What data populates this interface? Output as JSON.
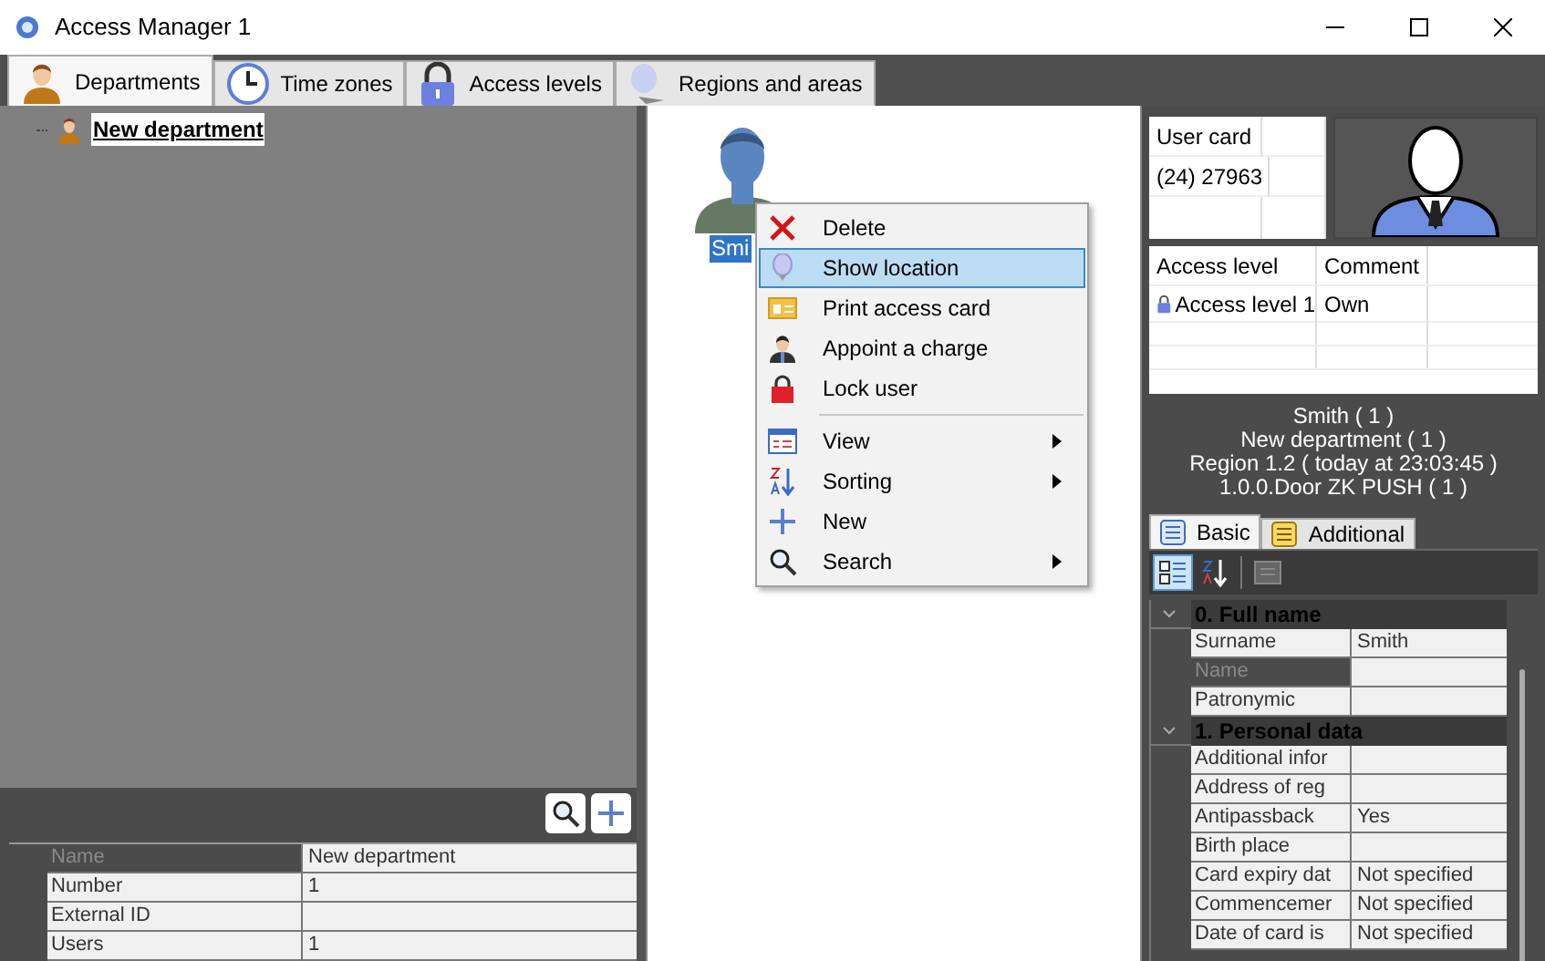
{
  "window": {
    "title": "Access Manager 1"
  },
  "tabs": [
    {
      "label": "Departments",
      "selected": true
    },
    {
      "label": "Time zones",
      "selected": false
    },
    {
      "label": "Access levels",
      "selected": false
    },
    {
      "label": "Regions and areas",
      "selected": false
    }
  ],
  "department_tree": {
    "items": [
      {
        "label": "New department",
        "selected": true
      }
    ]
  },
  "department_properties": {
    "rows": [
      {
        "name": "Name",
        "value": "New department",
        "disabled": true
      },
      {
        "name": "Number",
        "value": "1",
        "disabled": false
      },
      {
        "name": "External ID",
        "value": "",
        "disabled": false
      },
      {
        "name": "Users",
        "value": "1",
        "disabled": false
      }
    ]
  },
  "user_tile": {
    "label": "Smi",
    "selected": true
  },
  "context_menu": {
    "items": [
      {
        "kind": "item",
        "label": "Delete",
        "selected": false,
        "submenu": false
      },
      {
        "kind": "item",
        "label": "Show location",
        "selected": true,
        "submenu": false
      },
      {
        "kind": "item",
        "label": "Print access card",
        "selected": false,
        "submenu": false
      },
      {
        "kind": "item",
        "label": "Appoint a charge",
        "selected": false,
        "submenu": false
      },
      {
        "kind": "item",
        "label": "Lock user",
        "selected": false,
        "submenu": false
      },
      {
        "kind": "separator"
      },
      {
        "kind": "item",
        "label": "View",
        "selected": false,
        "submenu": true
      },
      {
        "kind": "item",
        "label": "Sorting",
        "selected": false,
        "submenu": true
      },
      {
        "kind": "item",
        "label": "New",
        "selected": false,
        "submenu": false
      },
      {
        "kind": "item",
        "label": "Search",
        "selected": false,
        "submenu": true
      }
    ]
  },
  "user_card": {
    "header": "User card",
    "value": "(24) 27963"
  },
  "access_levels": {
    "columns": [
      "Access level",
      "Comment"
    ],
    "rows": [
      {
        "level": "Access level 1",
        "comment": "Own"
      }
    ]
  },
  "info_lines": [
    "Smith ( 1 )",
    "New department ( 1 )",
    "Region 1.2 ( today at 23:03:45 )",
    "1.0.0.Door ZK PUSH ( 1 )"
  ],
  "detail_tabs": [
    {
      "label": "Basic",
      "selected": true
    },
    {
      "label": "Additional",
      "selected": false
    }
  ],
  "property_grid": {
    "categories": [
      {
        "title": "0. Full name",
        "expanded": true,
        "rows": [
          {
            "name": "Surname",
            "value": "Smith",
            "disabled": false
          },
          {
            "name": "Name",
            "value": "",
            "disabled": true
          },
          {
            "name": "Patronymic",
            "value": "",
            "disabled": false
          }
        ]
      },
      {
        "title": "1. Personal data",
        "expanded": true,
        "rows": [
          {
            "name": "Additional infor",
            "value": "",
            "disabled": false
          },
          {
            "name": "Address of reg",
            "value": "",
            "disabled": false
          },
          {
            "name": "Antipassback",
            "value": "Yes",
            "disabled": false
          },
          {
            "name": "Birth place",
            "value": "",
            "disabled": false
          },
          {
            "name": "Card expiry dat",
            "value": "Not specified",
            "disabled": false
          },
          {
            "name": "Commencemer",
            "value": "Not specified",
            "disabled": false
          },
          {
            "name": "Date of card is",
            "value": "Not specified",
            "disabled": false
          }
        ]
      }
    ]
  }
}
